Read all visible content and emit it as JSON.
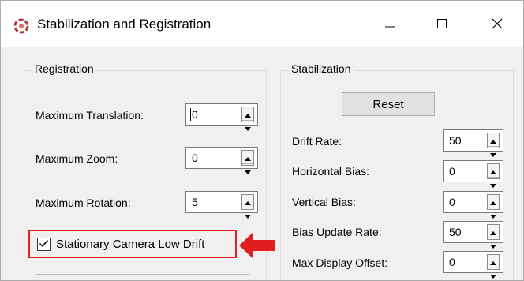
{
  "window": {
    "title": "Stabilization and Registration",
    "icons": {
      "app": "app-logo-icon",
      "minimize": "minimize-icon",
      "maximize": "maximize-icon",
      "close": "close-icon"
    }
  },
  "registration": {
    "title": "Registration",
    "fields": [
      {
        "label": "Maximum Translation:",
        "value": "0",
        "focused": true
      },
      {
        "label": "Maximum Zoom:",
        "value": "0"
      },
      {
        "label": "Maximum Rotation:",
        "value": "5"
      }
    ],
    "checkbox": {
      "label": "Stationary Camera Low Drift",
      "checked": true
    }
  },
  "stabilization": {
    "title": "Stabilization",
    "reset_label": "Reset",
    "fields": [
      {
        "label": "Drift Rate:",
        "value": "50"
      },
      {
        "label": "Horizontal Bias:",
        "value": "0"
      },
      {
        "label": "Vertical Bias:",
        "value": "0"
      },
      {
        "label": "Bias Update Rate:",
        "value": "50"
      },
      {
        "label": "Max Display Offset:",
        "value": "0"
      }
    ]
  },
  "annotation": {
    "arrow_color": "#e02020",
    "highlight_color": "#e02020",
    "icon": "red-arrow-icon"
  }
}
